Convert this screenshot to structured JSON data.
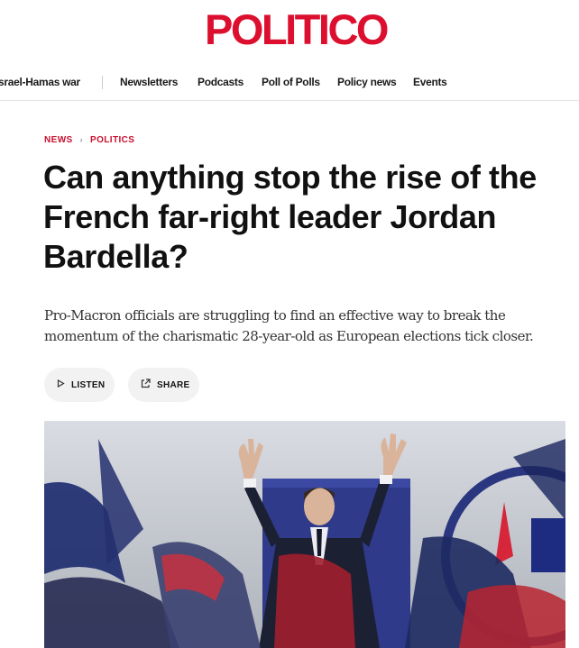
{
  "brand": {
    "logo_text": "POLITICO",
    "accent": "#dc0f2f"
  },
  "nav": {
    "items": [
      {
        "label": "srael-Hamas war"
      },
      {
        "label": "Newsletters"
      },
      {
        "label": "Podcasts"
      },
      {
        "label": "Poll of Polls"
      },
      {
        "label": "Policy news"
      },
      {
        "label": "Events"
      }
    ]
  },
  "breadcrumb": {
    "section": "NEWS",
    "subsection": "POLITICS"
  },
  "article": {
    "headline": "Can anything stop the rise of the French far-right leader Jordan Bardella?",
    "dek": "Pro-Macron officials are struggling to find an effective way to break the momentum of the charismatic 28-year-old as European elections tick closer."
  },
  "actions": {
    "listen_label": "LISTEN",
    "share_label": "SHARE"
  },
  "icons": {
    "listen": "play-icon",
    "share": "share-icon"
  }
}
